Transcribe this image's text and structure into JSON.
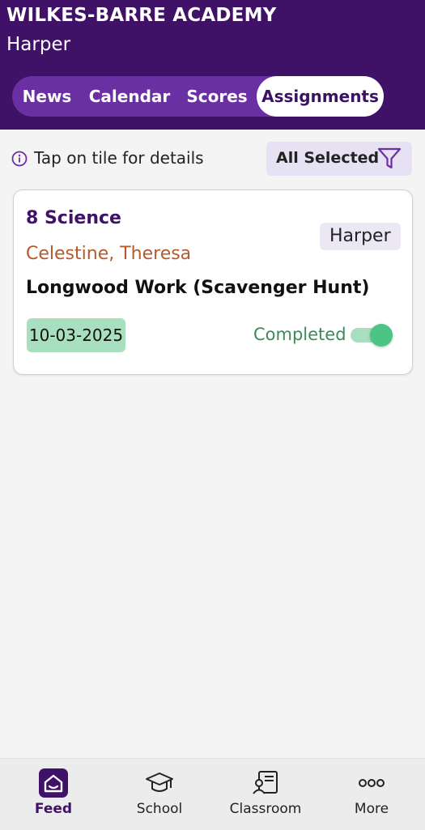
{
  "header": {
    "school_name": "WILKES-BARRE ACADEMY",
    "student_name": "Harper"
  },
  "tabs": [
    {
      "label": "News",
      "active": false
    },
    {
      "label": "Calendar",
      "active": false
    },
    {
      "label": "Scores",
      "active": false
    },
    {
      "label": "Assignments",
      "active": true
    }
  ],
  "hint": {
    "text": "Tap on tile for details",
    "icon": "info-icon"
  },
  "filter": {
    "label": "All Selected",
    "icon": "filter-icon"
  },
  "assignment": {
    "course": "8 Science",
    "teacher": "Celestine, Theresa",
    "student_badge": "Harper",
    "title": "Longwood Work (Scavenger Hunt)",
    "due_date": "10-03-2025",
    "status_label": "Completed",
    "completed": true
  },
  "bottom_nav": [
    {
      "label": "Feed",
      "icon": "home-icon",
      "active": true
    },
    {
      "label": "School",
      "icon": "graduation-cap-icon",
      "active": false
    },
    {
      "label": "Classroom",
      "icon": "classroom-board-icon",
      "active": false
    },
    {
      "label": "More",
      "icon": "more-dots-icon",
      "active": false
    }
  ],
  "colors": {
    "header_bg": "#3f1268",
    "tab_bar_bg": "#6a2fa3",
    "teacher_text": "#b55a2b",
    "date_chip": "#a8dfbf",
    "status_green": "#3b8a5a",
    "toggle_knob": "#4cc485"
  }
}
